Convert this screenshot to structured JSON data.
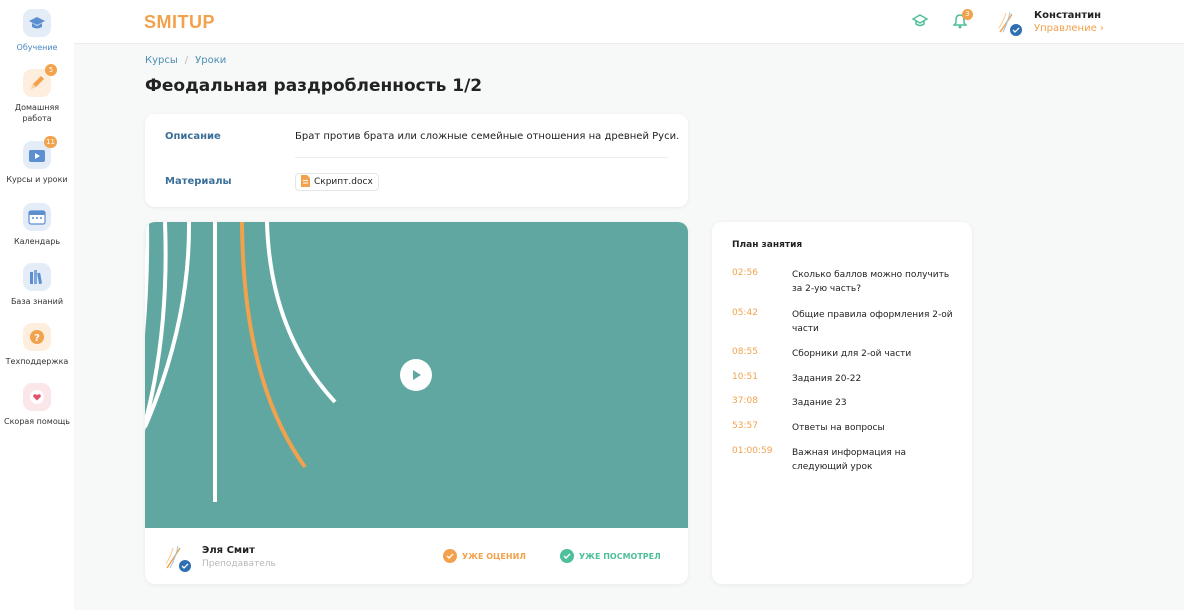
{
  "sidebar": {
    "items": [
      {
        "label": "Обучение",
        "icon": "graduation-cap-icon"
      },
      {
        "label": "Домашняя работа",
        "icon": "pencil-icon",
        "badge": "5"
      },
      {
        "label": "Курсы и уроки",
        "icon": "video-icon",
        "badge": "11"
      },
      {
        "label": "Календарь",
        "icon": "calendar-icon"
      },
      {
        "label": "База знаний",
        "icon": "books-icon"
      },
      {
        "label": "Техподдержка",
        "icon": "question-icon"
      },
      {
        "label": "Скорая помощь",
        "icon": "heart-icon"
      }
    ]
  },
  "header": {
    "logo": "SMITUP",
    "notifications_count": "3",
    "user_name": "Константин",
    "user_role": "Управление"
  },
  "breadcrumb": [
    "Курсы",
    "Уроки"
  ],
  "page_title": "Феодальная раздробленность 1/2",
  "description": {
    "label": "Описание",
    "text": "Брат против брата или сложные семейные отношения на древней Руси.",
    "materials_label": "Материалы",
    "file_name": "Скрипт.docx"
  },
  "teacher": {
    "name": "Эля Смит",
    "role": "Преподаватель"
  },
  "statuses": {
    "rated": "УЖЕ ОЦЕНИЛ",
    "watched": "УЖЕ ПОСМОТРЕЛ"
  },
  "plan": {
    "title": "План занятия",
    "items": [
      {
        "time": "02:56",
        "text": "Сколько баллов можно получить за 2-ую часть?"
      },
      {
        "time": "05:42",
        "text": "Общие правила оформления 2-ой части"
      },
      {
        "time": "08:55",
        "text": "Сборники для 2-ой части"
      },
      {
        "time": "10:51",
        "text": "Задания 20-22"
      },
      {
        "time": "37:08",
        "text": "Задание 23"
      },
      {
        "time": "53:57",
        "text": "Ответы на вопросы"
      },
      {
        "time": "01:00:59",
        "text": "Важная информация на следующий урок"
      }
    ]
  },
  "colors": {
    "accent": "#f2a24c",
    "teal": "#5fa7a0",
    "link": "#4d8fb3",
    "green": "#4dbf9a"
  }
}
